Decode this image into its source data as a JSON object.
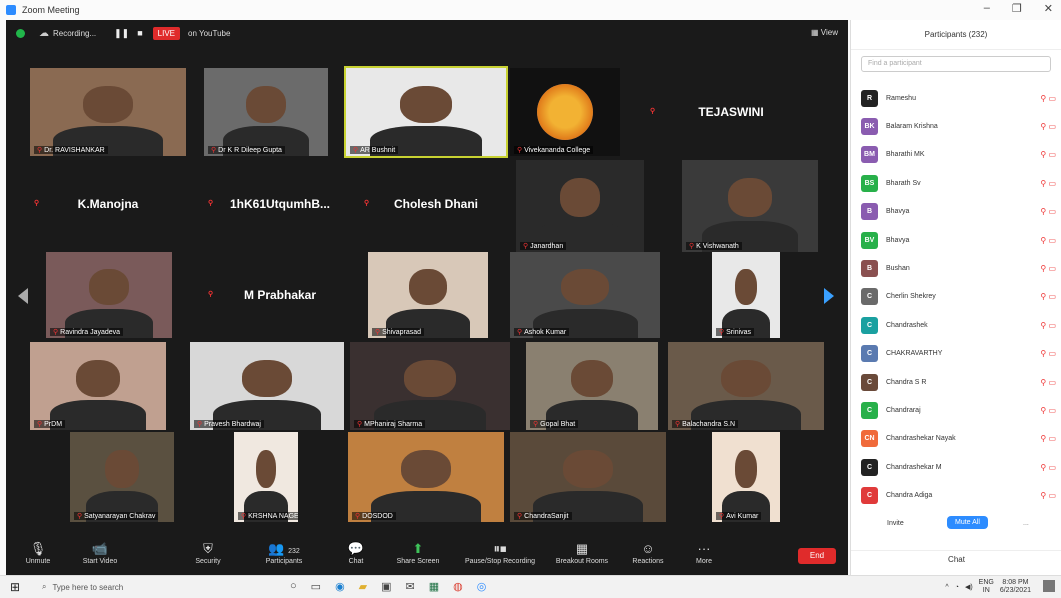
{
  "window": {
    "title": "Zoom Meeting",
    "controls": [
      "–",
      "❐",
      "✕"
    ]
  },
  "topbar": {
    "recording": "Recording...",
    "live": "LIVE",
    "live_on": "on YouTube",
    "view": "View"
  },
  "tiles": [
    {
      "label": "Dr. RAVISHANKAR",
      "bg": "#8a6a52"
    },
    {
      "label": "Dr K R Dileep Gupta",
      "bg": "#6b6b6b"
    },
    {
      "label": "AR Bushnit",
      "bg": "#e8e8e8",
      "active": true
    },
    {
      "label": "Vivekananda College",
      "bg": "#111",
      "logo": true
    },
    {
      "name": "TEJASWINI"
    },
    {
      "name": "K.Manojna"
    },
    {
      "name": "1hK61UtqumhB..."
    },
    {
      "name": "Cholesh Dhani"
    },
    {
      "label": "Janardhan",
      "bg": "#2a2a2a"
    },
    {
      "label": "K Vishwanath",
      "bg": "#3a3a3a"
    },
    {
      "label": "Ravindra Jayadeva",
      "bg": "#7a5a5a"
    },
    {
      "name": "M Prabhakar"
    },
    {
      "label": "Shivaprasad",
      "bg": "#d8c8b8"
    },
    {
      "label": "Ashok Kumar",
      "bg": "#4a4a4a"
    },
    {
      "label": "Srinivas",
      "bg": "#e8e8e8"
    },
    {
      "label": "PrDM",
      "bg": "#c0a090"
    },
    {
      "label": "Pravesh Bhardwaj",
      "bg": "#d8d8d8"
    },
    {
      "label": "MPhaniraj Sharma",
      "bg": "#3a3030"
    },
    {
      "label": "Gopal Bhat",
      "bg": "#8a8070"
    },
    {
      "label": "Balachandra S.N",
      "bg": "#6a5a4a"
    },
    {
      "label": "Satyanarayan Chakrav",
      "bg": "#5a5040"
    },
    {
      "label": "KRSHNA NAGESH",
      "bg": "#f0e8e0"
    },
    {
      "label": "DOSDOD",
      "bg": "#c08040"
    },
    {
      "label": "ChandraSanjit",
      "bg": "#5a4a3a"
    },
    {
      "label": "Avi Kumar",
      "bg": "#f0e0d0"
    }
  ],
  "toolbar": {
    "unmute": "Unmute",
    "video": "Start Video",
    "security": "Security",
    "participants": "Participants",
    "participants_count": "232",
    "chat": "Chat",
    "share": "Share Screen",
    "record": "Pause/Stop Recording",
    "breakout": "Breakout Rooms",
    "reactions": "Reactions",
    "more": "More",
    "end": "End"
  },
  "panel": {
    "title": "Participants (232)",
    "search_placeholder": "Find a participant",
    "participants": [
      {
        "name": "Rameshu",
        "initials": "R",
        "color": "#222"
      },
      {
        "name": "Balaram Krishna",
        "initials": "BK",
        "color": "#8a5cb0"
      },
      {
        "name": "Bharathi MK",
        "initials": "BM",
        "color": "#8a5cb0"
      },
      {
        "name": "Bharath Sv",
        "initials": "BS",
        "color": "#28b04a"
      },
      {
        "name": "Bhavya",
        "initials": "B",
        "color": "#8a5cb0"
      },
      {
        "name": "Bhavya",
        "initials": "BV",
        "color": "#28b04a"
      },
      {
        "name": "Bushan",
        "initials": "B",
        "color": "#8a5050"
      },
      {
        "name": "Cherlin Shekrey",
        "initials": "C",
        "color": "#6a6a6a"
      },
      {
        "name": "Chandrashek",
        "initials": "C",
        "color": "#1aa0a0"
      },
      {
        "name": "CHAKRAVARTHY",
        "initials": "C",
        "color": "#5a7ab0"
      },
      {
        "name": "Chandra S R",
        "initials": "C",
        "color": "#6a4a3a"
      },
      {
        "name": "Chandraraj",
        "initials": "C",
        "color": "#28b04a"
      },
      {
        "name": "Chandrashekar Nayak",
        "initials": "CN",
        "color": "#f06a3a"
      },
      {
        "name": "Chandrashekar M",
        "initials": "C",
        "color": "#222"
      },
      {
        "name": "Chandra Adiga",
        "initials": "C",
        "color": "#e03a3a"
      }
    ],
    "invite": "Invite",
    "mute_all": "Mute All",
    "more": "...",
    "chat": "Chat"
  },
  "taskbar": {
    "search": "Type here to search",
    "lang": "ENG",
    "lang2": "IN",
    "time": "8:08 PM",
    "date": "6/23/2021"
  }
}
